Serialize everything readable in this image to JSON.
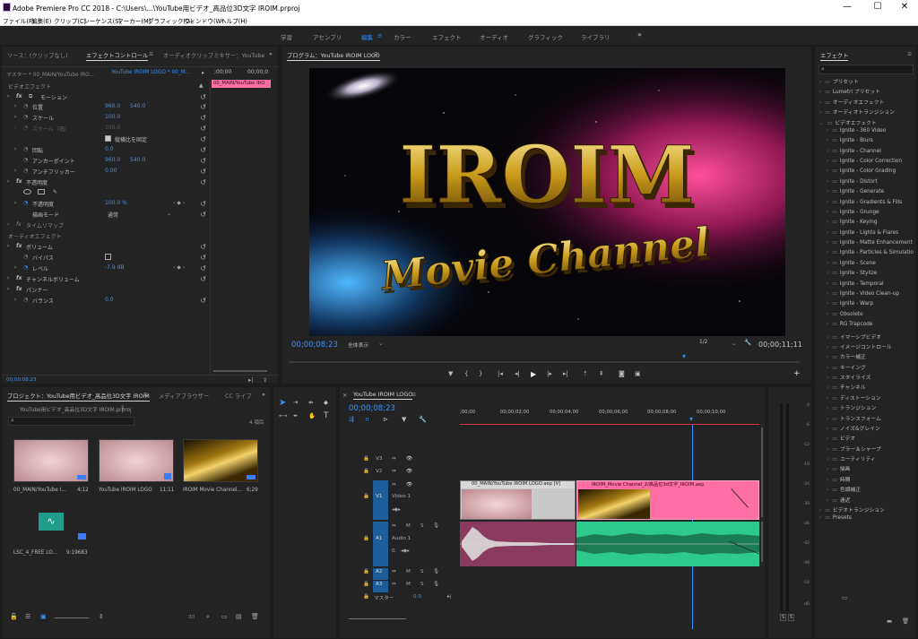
{
  "window": {
    "title": "Adobe Premiere Pro CC 2018 - C:\\Users\\...\\YouTube用ビデオ_高品位3D文字 IROIM.prproj",
    "min": "—",
    "max": "☐",
    "close": "✕"
  },
  "menu": [
    "ファイル(F)",
    "編集(E)",
    "クリップ(C)",
    "シーケンス(S)",
    "マーカー(M)",
    "グラフィック(G)",
    "ウィンドウ(W)",
    "ヘルプ(H)"
  ],
  "workspaces": [
    "学習",
    "アセンブリ",
    "編集",
    "カラー",
    "エフェクト",
    "オーディオ",
    "グラフィック",
    "ライブラリ"
  ],
  "workspaces_more": "»",
  "effect_controls": {
    "tabs": [
      "ソース：(クリップなし)",
      "エフェクトコントロール",
      "オーディオクリップミキサー：YouTube"
    ],
    "master": "マスター * 00_MAIN/YouTube IRO...",
    "clip": "YouTube IROIM LOGO * 00_M...",
    "time_left": ";00;00",
    "time_right": "00;00;0",
    "clip_name": "00_MAIN/YouTube IRO",
    "video_effects": "ビデオエフェクト",
    "motion": "モーション",
    "position_label": "位置",
    "position_x": "960.0",
    "position_y": "540.0",
    "scale_label": "スケール",
    "scale_val": "100.0",
    "scale_w_label": "スケール（幅）",
    "scale_w_val": "100.0",
    "uniform_label": "縦横比を固定",
    "rotation_label": "回転",
    "rotation_val": "0.0",
    "anchor_label": "アンカーポイント",
    "anchor_x": "960.0",
    "anchor_y": "540.0",
    "flicker_label": "アンチフリッカー",
    "flicker_val": "0.00",
    "opacity_section": "不透明度",
    "opacity_label": "不透明度",
    "opacity_val": "100.0 %",
    "blend_label": "描画モード",
    "blend_val": "通常",
    "remap_label": "タイムリマップ",
    "audio_effects": "オーディオエフェクト",
    "volume": "ボリューム",
    "bypass_label": "バイパス",
    "level_label": "レベル",
    "level_val": "-7.9 dB",
    "channel_volume": "チャンネルボリューム",
    "panner": "パンナー",
    "balance_label": "バランス",
    "balance_val": "0.0",
    "bottom_time": "00;00;08;23"
  },
  "program": {
    "tab": "プログラム：YouTube IROIM LOGO",
    "headline": "IROIM",
    "subline": "Movie Channel",
    "timecode": "00;00;08;23",
    "fit": "全体表示",
    "res": "1/2",
    "duration": "00;00;11;11"
  },
  "project": {
    "tabs": [
      "プロジェクト：YouTube用ビデオ_高品位3D文字 IROIM",
      "メディアブラウザー",
      "CC ライブ"
    ],
    "path": "YouTube用ビデオ_高品位3D文字 IROIM.prproj",
    "count": "4 項目",
    "items": [
      {
        "name": "00_MAIN/YouTube I...",
        "dur": "4;12"
      },
      {
        "name": "YouTube IROIM LOGO",
        "dur": "11;11"
      },
      {
        "name": "IROIM Movie Channel...",
        "dur": "6;29"
      },
      {
        "name": "LSC_4_FREE LO...",
        "dur": "9:19683"
      }
    ]
  },
  "timeline": {
    "tab": "YouTube IROIM LOGO",
    "timecode": "00;00;08;23",
    "ruler": [
      ";00;00",
      "00;00;02;00",
      "00;00;04;00",
      "00;00;06;00",
      "00;00;08;00",
      "00;00;10;00"
    ],
    "tracks": [
      "V3",
      "V2",
      "V1",
      "A1",
      "A2",
      "A3"
    ],
    "v1_name": "Video 1",
    "a1_name": "Audio 1",
    "master": "マスター",
    "master_val": "0.0",
    "a1_level": "0.",
    "clip_v1a": "00_MAIN/YouTube IROIM LOGO.aep [V]",
    "clip_v1b": "IROIM_Movie Channel_2/高品位3d文字_IROIM.aep"
  },
  "effects": {
    "title": "エフェクト",
    "items": [
      {
        "label": "プリセット",
        "level": 0
      },
      {
        "label": "Lumetri プリセット",
        "level": 0
      },
      {
        "label": "オーディオエフェクト",
        "level": 0
      },
      {
        "label": "オーディオトランジション",
        "level": 0
      },
      {
        "label": "ビデオエフェクト",
        "level": 0,
        "open": true
      },
      {
        "label": "Ignite - 360 Video",
        "level": 1
      },
      {
        "label": "Ignite - Blurs",
        "level": 1
      },
      {
        "label": "Ignite - Channel",
        "level": 1
      },
      {
        "label": "Ignite - Color Correction",
        "level": 1
      },
      {
        "label": "Ignite - Color Grading",
        "level": 1
      },
      {
        "label": "Ignite - Distort",
        "level": 1
      },
      {
        "label": "Ignite - Generate",
        "level": 1
      },
      {
        "label": "Ignite - Gradients & Fills",
        "level": 1
      },
      {
        "label": "Ignite - Grunge",
        "level": 1
      },
      {
        "label": "Ignite - Keying",
        "level": 1
      },
      {
        "label": "Ignite - Lights & Flares",
        "level": 1
      },
      {
        "label": "Ignite - Matte Enhancement",
        "level": 1
      },
      {
        "label": "Ignite - Particles & Simulatio",
        "level": 1
      },
      {
        "label": "Ignite - Scene",
        "level": 1
      },
      {
        "label": "Ignite - Stylize",
        "level": 1
      },
      {
        "label": "Ignite - Temporal",
        "level": 1
      },
      {
        "label": "Ignite - Video Clean-up",
        "level": 1
      },
      {
        "label": "Ignite - Warp",
        "level": 1
      },
      {
        "label": "Obsolete",
        "level": 1
      },
      {
        "label": "RG Trapcode",
        "level": 1
      },
      {
        "label": "イマーシブビデオ",
        "level": 1
      },
      {
        "label": "イメージコントロール",
        "level": 1
      },
      {
        "label": "カラー補正",
        "level": 1
      },
      {
        "label": "キーイング",
        "level": 1
      },
      {
        "label": "スタイライズ",
        "level": 1
      },
      {
        "label": "チャンネル",
        "level": 1
      },
      {
        "label": "ディストーション",
        "level": 1
      },
      {
        "label": "トランジション",
        "level": 1
      },
      {
        "label": "トランスフォーム",
        "level": 1
      },
      {
        "label": "ノイズ&グレイン",
        "level": 1
      },
      {
        "label": "ビデオ",
        "level": 1
      },
      {
        "label": "ブラー＆シャープ",
        "level": 1
      },
      {
        "label": "ユーティリティ",
        "level": 1
      },
      {
        "label": "描画",
        "level": 1
      },
      {
        "label": "時間",
        "level": 1
      },
      {
        "label": "色調補正",
        "level": 1
      },
      {
        "label": "遠近",
        "level": 1
      },
      {
        "label": "ビデオトランジション",
        "level": 0
      },
      {
        "label": "Presets",
        "level": 0
      }
    ]
  },
  "meter": {
    "scale": [
      "0",
      "-6",
      "-12",
      "-18",
      "-24",
      "-30",
      "-36",
      "-42",
      "-48",
      "-54",
      "dB"
    ],
    "solo": "S"
  },
  "colors": {
    "accent": "#2f8fff",
    "clip_pink": "#ff6fa5",
    "audio_green": "#2ec98d",
    "audio_maroon": "#8a3a5c",
    "track_blue": "#1d5e9a"
  }
}
